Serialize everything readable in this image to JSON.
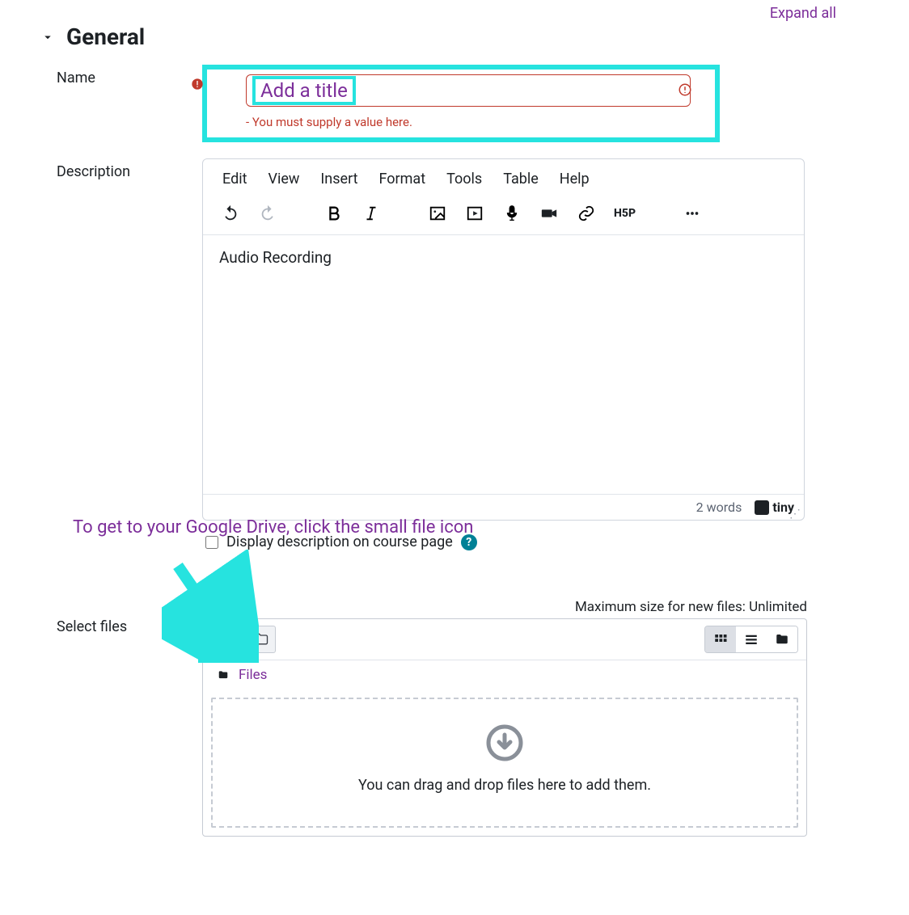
{
  "top": {
    "expand_all": "Expand all"
  },
  "section": {
    "title": "General"
  },
  "name_field": {
    "label": "Name",
    "overlay_text": "Add a title",
    "error": "- You must supply a value here."
  },
  "description": {
    "label": "Description",
    "menu": {
      "edit": "Edit",
      "view": "View",
      "insert": "Insert",
      "format": "Format",
      "tools": "Tools",
      "table": "Table",
      "help": "Help"
    },
    "content": "Audio Recording",
    "word_count": "2 words",
    "tiny_brand": "tiny",
    "display_checkbox_label": "Display description on course page"
  },
  "annotation": {
    "text": "To get to your Google Drive, click the small file icon"
  },
  "select_files": {
    "label": "Select files",
    "max_size": "Maximum size for new files: Unlimited",
    "breadcrumb": "Files",
    "drop_text": "You can drag and drop files here to add them."
  }
}
